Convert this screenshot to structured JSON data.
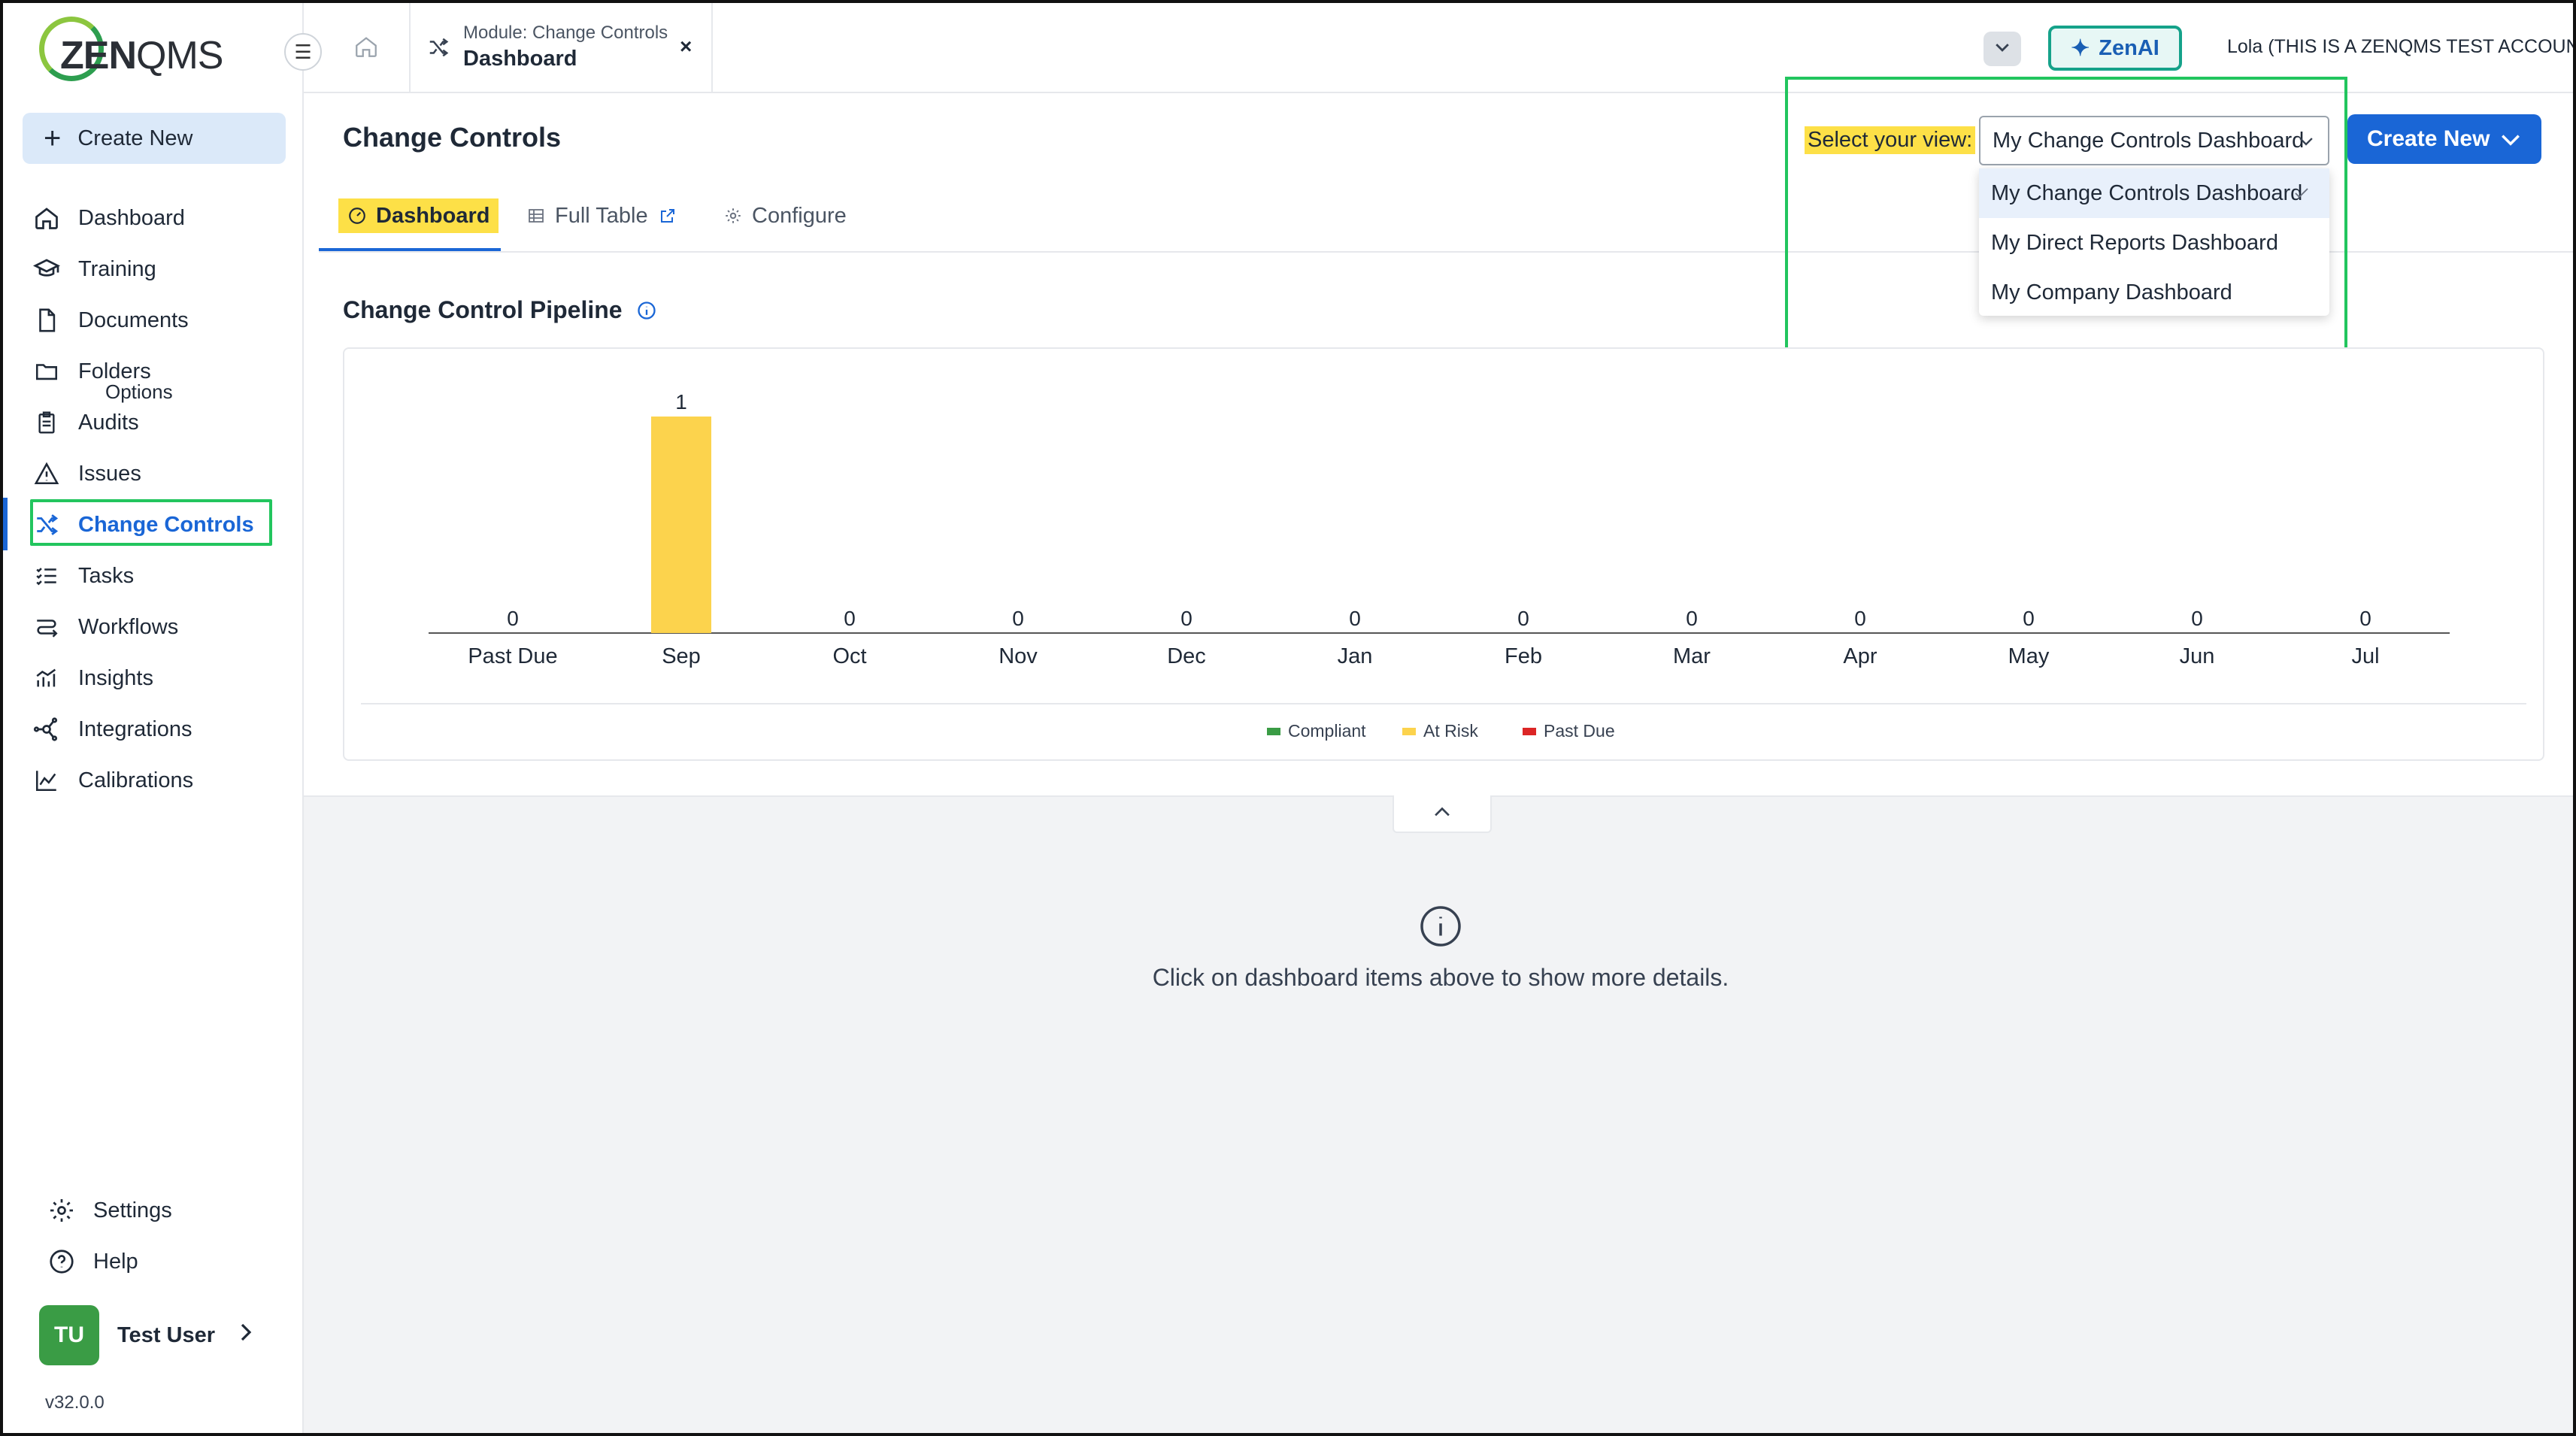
{
  "logo": {
    "zen": "ZEN",
    "qms": "QMS"
  },
  "sidebar": {
    "create_new": "Create New",
    "items": [
      {
        "label": "Dashboard",
        "icon": "home-icon"
      },
      {
        "label": "Training",
        "icon": "graduation-cap-icon"
      },
      {
        "label": "Documents",
        "icon": "document-icon"
      },
      {
        "label": "Folders",
        "icon": "folder-icon"
      },
      {
        "label": "Audits",
        "icon": "clipboard-icon"
      },
      {
        "label": "Issues",
        "icon": "warning-icon"
      },
      {
        "label": "Change Controls",
        "icon": "shuffle-icon",
        "active": true
      },
      {
        "label": "Tasks",
        "icon": "checklist-icon"
      },
      {
        "label": "Workflows",
        "icon": "workflow-icon"
      },
      {
        "label": "Insights",
        "icon": "bar-chart-icon"
      },
      {
        "label": "Integrations",
        "icon": "network-icon"
      },
      {
        "label": "Calibrations",
        "icon": "line-chart-icon"
      }
    ],
    "options_sublabel": "Options",
    "settings": "Settings",
    "help": "Help",
    "user": {
      "initials": "TU",
      "name": "Test User"
    },
    "version": "v32.0.0"
  },
  "topbar": {
    "module_tab": {
      "subtitle": "Module: Change Controls",
      "title": "Dashboard",
      "close": "×"
    },
    "zenai": "ZenAI",
    "account": "Lola (THIS IS A ZENQMS TEST ACCOUNT)"
  },
  "page": {
    "title": "Change Controls",
    "tabs": {
      "dashboard": "Dashboard",
      "full_table": "Full Table",
      "configure": "Configure"
    },
    "view_label": "Select your view:",
    "view_selected": "My Change Controls Dashboard",
    "view_options": [
      "My Change Controls Dashboard",
      "My Direct Reports Dashboard",
      "My Company Dashboard"
    ],
    "create_new": "Create New",
    "pipeline_title": "Change Control Pipeline",
    "details_hint": "Click on dashboard items above to show more details."
  },
  "colors": {
    "accent": "#1a66d6",
    "highlight": "#fde047",
    "compliant": "#3a9c45",
    "at_risk": "#fcd34d",
    "past_due": "#dc2626"
  },
  "chart_data": {
    "type": "bar",
    "categories": [
      "Past Due",
      "Sep",
      "Oct",
      "Nov",
      "Dec",
      "Jan",
      "Feb",
      "Mar",
      "Apr",
      "May",
      "Jun",
      "Jul"
    ],
    "series": [
      {
        "name": "Compliant",
        "color": "#3a9c45",
        "values": [
          0,
          0,
          0,
          0,
          0,
          0,
          0,
          0,
          0,
          0,
          0,
          0
        ]
      },
      {
        "name": "At Risk",
        "color": "#fcd34d",
        "values": [
          0,
          1,
          0,
          0,
          0,
          0,
          0,
          0,
          0,
          0,
          0,
          0
        ]
      },
      {
        "name": "Past Due",
        "color": "#dc2626",
        "values": [
          0,
          0,
          0,
          0,
          0,
          0,
          0,
          0,
          0,
          0,
          0,
          0
        ]
      }
    ],
    "totals": [
      0,
      1,
      0,
      0,
      0,
      0,
      0,
      0,
      0,
      0,
      0,
      0
    ],
    "ylim": [
      0,
      1
    ],
    "grid": false,
    "legend": "bottom-center"
  }
}
